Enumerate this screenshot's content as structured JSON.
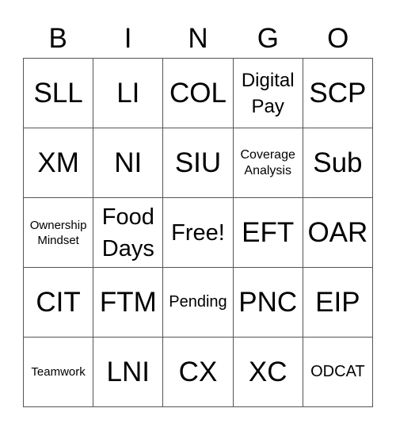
{
  "header": {
    "letters": [
      "B",
      "I",
      "N",
      "G",
      "O"
    ]
  },
  "board": {
    "rows": [
      [
        "SLL",
        "LI",
        "COL",
        "Digital Pay",
        "SCP"
      ],
      [
        "XM",
        "NI",
        "SIU",
        "Coverage Analysis",
        "Sub"
      ],
      [
        "Ownership Mindset",
        "Food Days",
        "Free!",
        "EFT",
        "OAR"
      ],
      [
        "CIT",
        "FTM",
        "Pending",
        "PNC",
        "EIP"
      ],
      [
        "Teamwork",
        "LNI",
        "CX",
        "XC",
        "ODCAT"
      ]
    ],
    "free_space": "Free!"
  }
}
